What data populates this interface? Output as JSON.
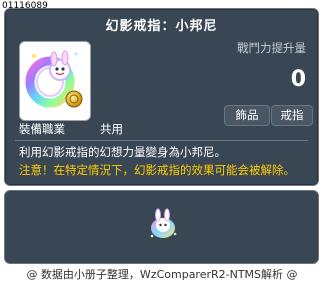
{
  "item_id": "01116089",
  "item": {
    "name": "幻影戒指：小邦尼",
    "icon_name": "rainbow-ring-icon",
    "power_label": "戰鬥力提升量",
    "power_value": "0",
    "tags": [
      "飾品",
      "戒指"
    ],
    "job_label": "裝備職業",
    "job_value": "共用",
    "description": "利用幻影戒指的幻想力量變身為小邦尼。",
    "warning": "注意！在特定情況下，幻影戒指的效果可能会被解除。"
  },
  "preview": {
    "icon_name": "bunny-preview-icon"
  },
  "footer": "@ 数据由小册子整理，WzComparerR2-NTMS解析 @",
  "colors": {
    "panel": "#394755",
    "warning": "#ffcc00",
    "border": "#6b7683"
  }
}
